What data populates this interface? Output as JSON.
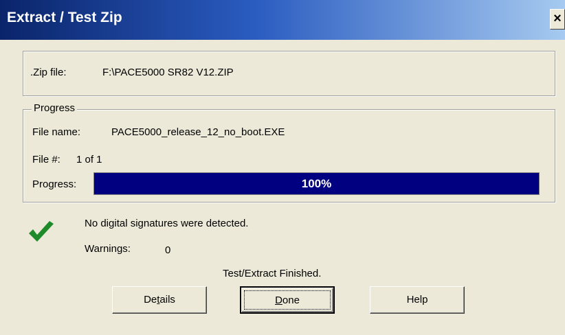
{
  "window": {
    "title": "Extract / Test Zip",
    "close_glyph": "×"
  },
  "zip": {
    "label": ".Zip file:",
    "value": "F:\\PACE5000 SR82 V12.ZIP"
  },
  "progress_group": {
    "legend": "Progress",
    "file_name_label": "File name:",
    "file_name_value": "PACE5000_release_12_no_boot.EXE",
    "file_num_label": "File #:",
    "file_num_value": "1 of 1",
    "progress_label": "Progress:",
    "progress_fraction": 1.0,
    "progress_text": "100%",
    "bar_color": "#000080"
  },
  "status": {
    "icon": "checkmark-icon",
    "icon_color": "#1f8a2a",
    "signature_message": "No digital signatures were detected.",
    "warnings_label": "Warnings:",
    "warnings_value": "0",
    "finished_message": "Test/Extract Finished."
  },
  "buttons": {
    "details": {
      "pre": "De",
      "mnemonic": "t",
      "post": "ails"
    },
    "done": {
      "pre": "",
      "mnemonic": "D",
      "post": "one"
    },
    "help": {
      "label": "Help"
    }
  }
}
